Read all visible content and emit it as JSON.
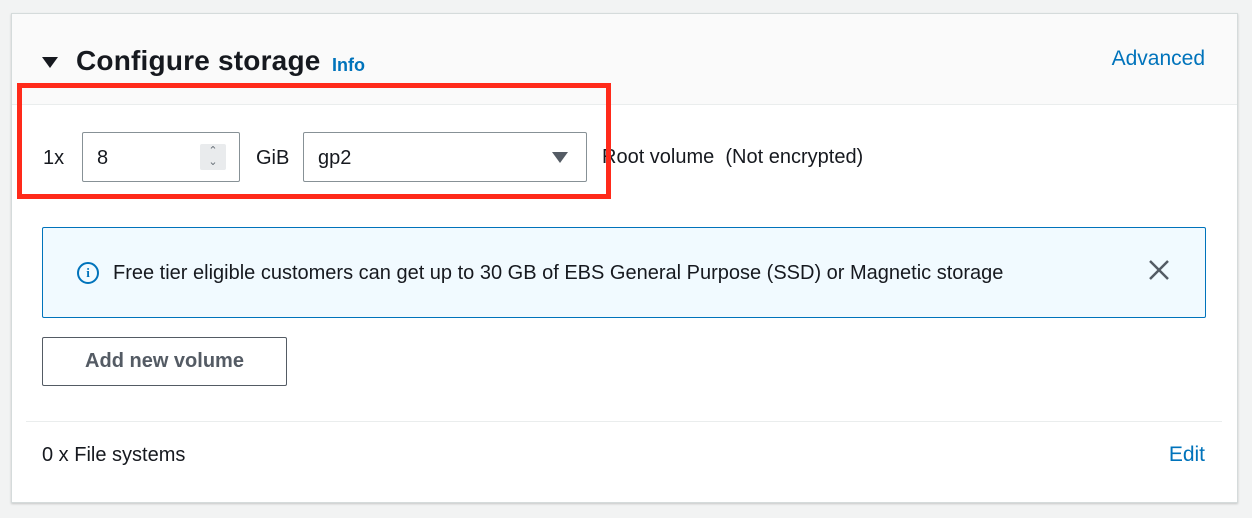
{
  "section": {
    "title": "Configure storage",
    "info_label": "Info",
    "advanced_label": "Advanced"
  },
  "volume": {
    "count_label": "1x",
    "size_value": "8",
    "size_unit": "GiB",
    "type_value": "gp2",
    "description": "Root volume  (Not encrypted)"
  },
  "alert": {
    "icon": "info-icon",
    "text": "Free tier eligible customers can get up to 30 GB of EBS General Purpose (SSD) or Magnetic storage",
    "close_icon": "close-icon"
  },
  "actions": {
    "add_volume_label": "Add new volume"
  },
  "file_systems": {
    "label": "0 x File systems",
    "edit_label": "Edit"
  },
  "colors": {
    "link": "#0073bb",
    "highlight": "#ff2a1a",
    "alert_bg": "#f1faff",
    "alert_border": "#0073bb"
  }
}
